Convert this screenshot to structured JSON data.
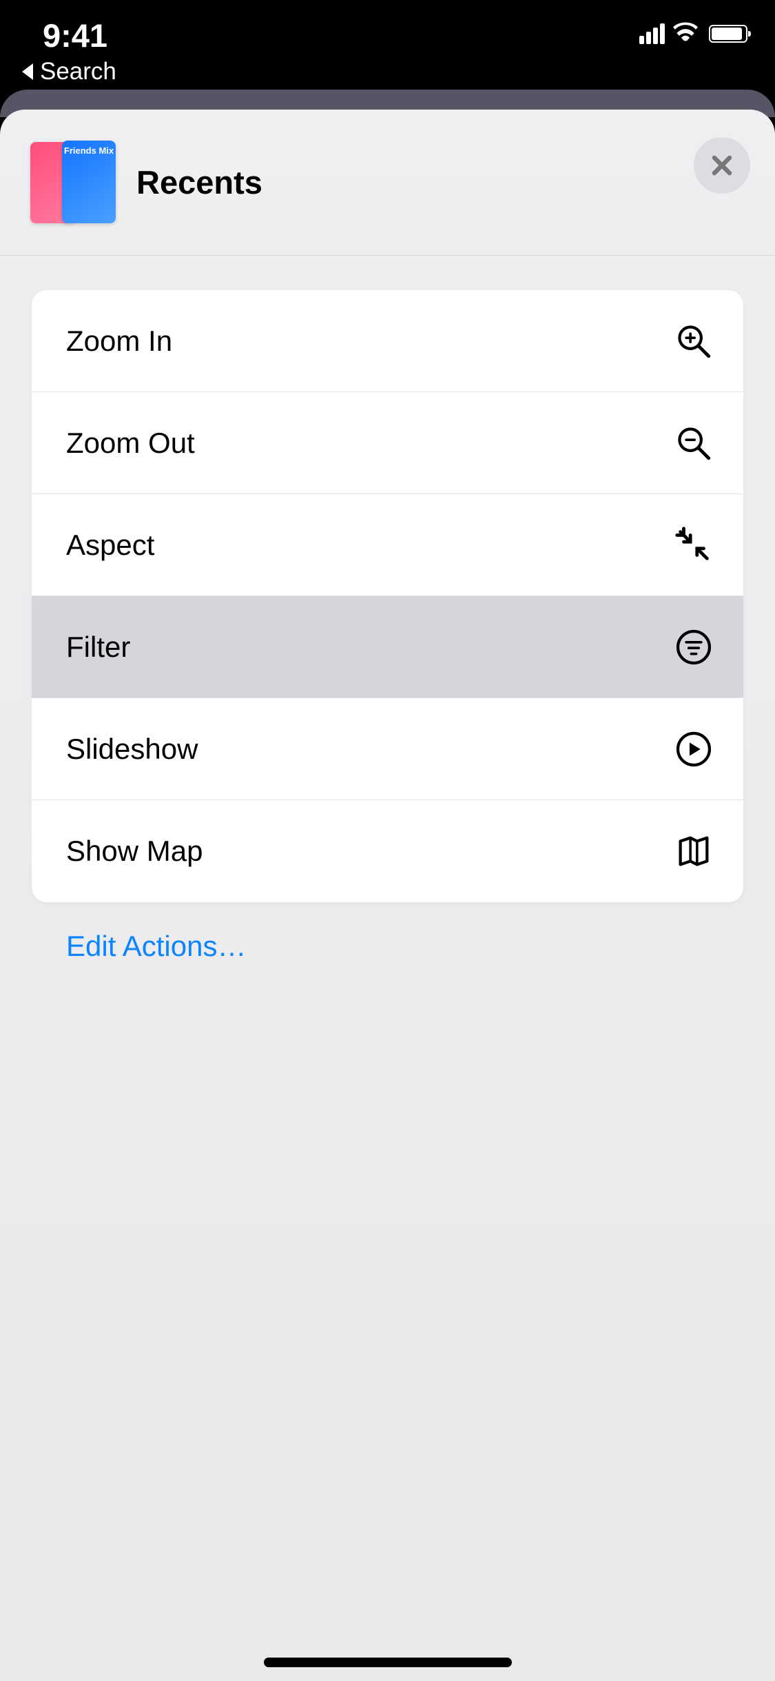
{
  "status_bar": {
    "time": "9:41",
    "back_label": "Search"
  },
  "sheet": {
    "title": "Recents",
    "thumb_label": "Friends Mix"
  },
  "actions": [
    {
      "label": "Zoom In",
      "icon": "zoom-in-icon",
      "highlighted": false
    },
    {
      "label": "Zoom Out",
      "icon": "zoom-out-icon",
      "highlighted": false
    },
    {
      "label": "Aspect",
      "icon": "aspect-icon",
      "highlighted": false
    },
    {
      "label": "Filter",
      "icon": "filter-icon",
      "highlighted": true
    },
    {
      "label": "Slideshow",
      "icon": "slideshow-icon",
      "highlighted": false
    },
    {
      "label": "Show Map",
      "icon": "map-icon",
      "highlighted": false
    }
  ],
  "edit_actions_label": "Edit Actions…"
}
